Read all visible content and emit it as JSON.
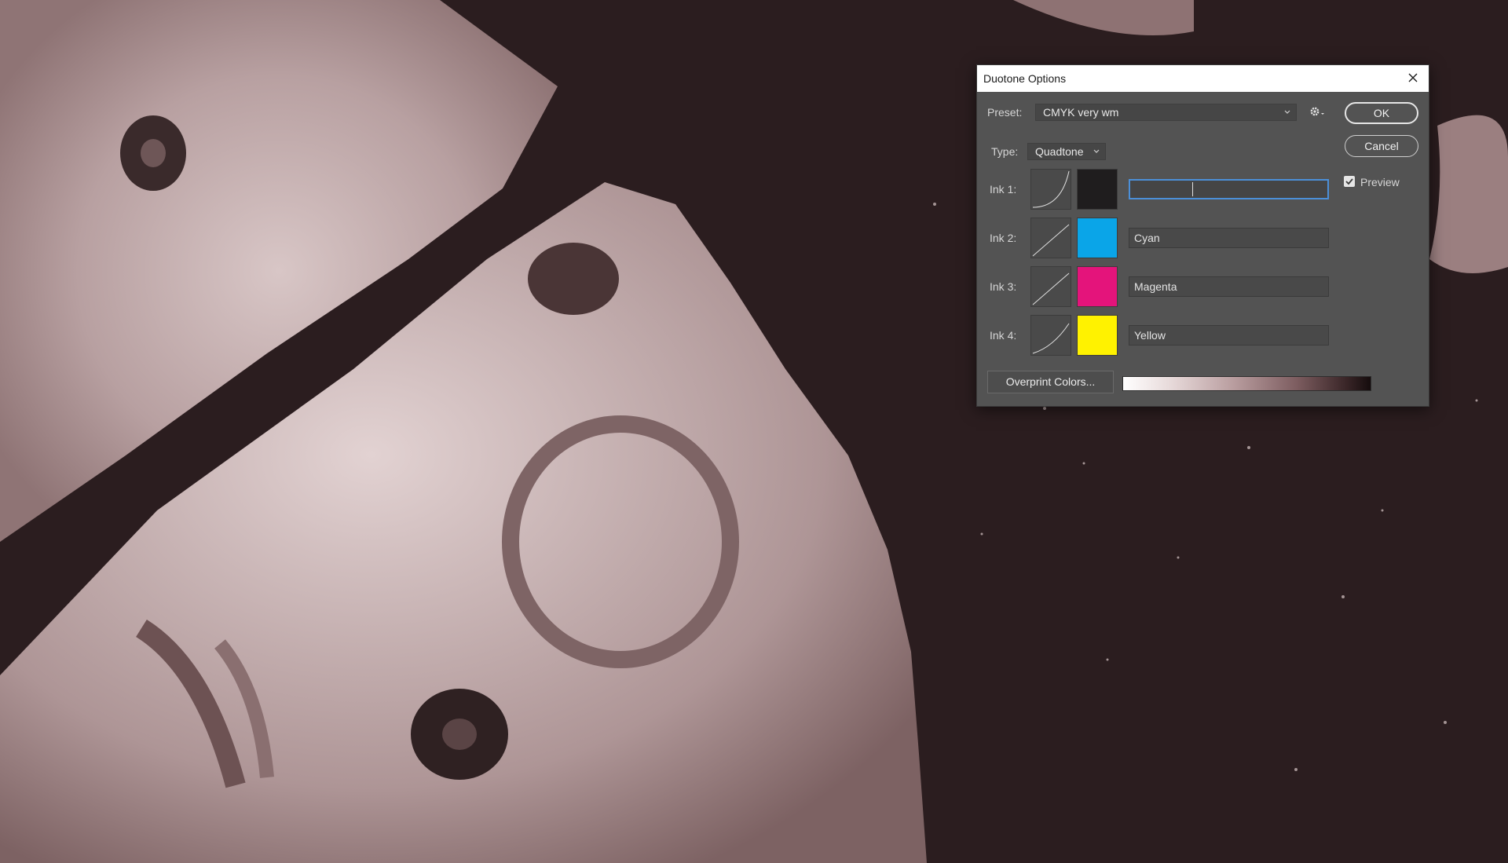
{
  "dialog": {
    "title": "Duotone Options",
    "preset": {
      "label": "Preset:",
      "value": "CMYK very wm"
    },
    "type": {
      "label": "Type:",
      "value": "Quadtone"
    },
    "buttons": {
      "ok": "OK",
      "cancel": "Cancel",
      "overprint": "Overprint Colors..."
    },
    "preview": {
      "label": "Preview",
      "checked": true
    },
    "inks": [
      {
        "label": "Ink 1:",
        "name": "",
        "color": "#1f1d1e"
      },
      {
        "label": "Ink 2:",
        "name": "Cyan",
        "color": "#0aa5e8"
      },
      {
        "label": "Ink 3:",
        "name": "Magenta",
        "color": "#e4147b"
      },
      {
        "label": "Ink 4:",
        "name": "Yellow",
        "color": "#fff200"
      }
    ]
  }
}
